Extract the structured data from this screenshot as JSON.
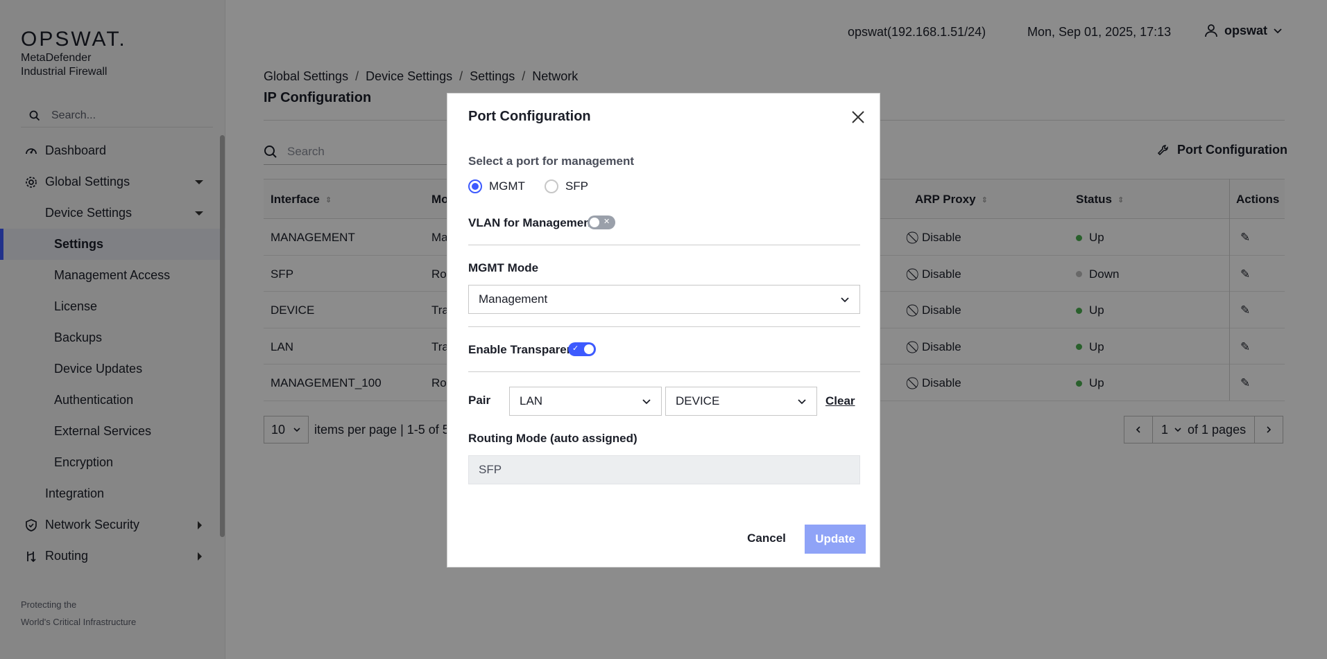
{
  "brand": {
    "logo": "OPSWAT.",
    "product_line1": "MetaDefender",
    "product_line2": "Industrial Firewall",
    "tagline1": "Protecting the",
    "tagline2": "World's Critical Infrastructure"
  },
  "sidebar": {
    "search_placeholder": "Search...",
    "items": [
      {
        "label": "Dashboard"
      },
      {
        "label": "Global Settings"
      },
      {
        "label": "Device Settings"
      },
      {
        "label": "Settings"
      },
      {
        "label": "Management Access"
      },
      {
        "label": "License"
      },
      {
        "label": "Backups"
      },
      {
        "label": "Device Updates"
      },
      {
        "label": "Authentication"
      },
      {
        "label": "External Services"
      },
      {
        "label": "Encryption"
      },
      {
        "label": "Integration"
      },
      {
        "label": "Network Security"
      },
      {
        "label": "Routing"
      }
    ]
  },
  "header": {
    "user_host": "opswat(192.168.1.51/24)",
    "datetime": "Mon, Sep 01, 2025, 17:13",
    "account": "opswat"
  },
  "breadcrumb": [
    "Global Settings",
    "Device Settings",
    "Settings",
    "Network"
  ],
  "breadcrumb_sep": "/",
  "page_title": "IP Configuration",
  "main": {
    "search_placeholder": "Search",
    "port_config_label": "Port Configuration",
    "columns": {
      "interface": "Interface",
      "mode": "Mo",
      "arp": "ARP Proxy",
      "status": "Status",
      "actions": "Actions"
    },
    "rows": [
      {
        "interface": "MANAGEMENT",
        "mode": "Ma",
        "arp": "Disable",
        "status": "Up",
        "status_color": "#4caf50"
      },
      {
        "interface": "SFP",
        "mode": "Rou",
        "arp": "Disable",
        "status": "Down",
        "status_color": "#bdbdbd"
      },
      {
        "interface": "DEVICE",
        "mode": "Tra",
        "arp": "Disable",
        "status": "Up",
        "status_color": "#4caf50"
      },
      {
        "interface": "LAN",
        "mode": "Tra",
        "arp": "Disable",
        "status": "Up",
        "status_color": "#4caf50"
      },
      {
        "interface": "MANAGEMENT_100",
        "mode": "Rou",
        "arp": "Disable",
        "status": "Up",
        "status_color": "#4caf50"
      }
    ],
    "per_page": "10",
    "items_info": "items per page | 1-5 of 5",
    "page": "1",
    "of_pages": "of 1 pages"
  },
  "modal": {
    "title": "Port Configuration",
    "select_port_label": "Select a port for management",
    "radio_mgmt": "MGMT",
    "radio_sfp": "SFP",
    "selected_port": "MGMT",
    "vlan_label": "VLAN for Management",
    "vlan_enabled": false,
    "mgmt_mode_label": "MGMT Mode",
    "mgmt_mode_value": "Management",
    "enable_transparent_label": "Enable Transparent",
    "transparent_enabled": true,
    "pair_label": "Pair",
    "pair_first": "LAN",
    "pair_second": "DEVICE",
    "clear_label": "Clear",
    "routing_label": "Routing Mode (auto assigned)",
    "routing_value": "SFP",
    "cancel_label": "Cancel",
    "update_label": "Update"
  },
  "colors": {
    "accent": "#3d5afe",
    "update_disabled": "#8fa3f7",
    "overlay": "rgba(0,0,0,0.45)"
  }
}
